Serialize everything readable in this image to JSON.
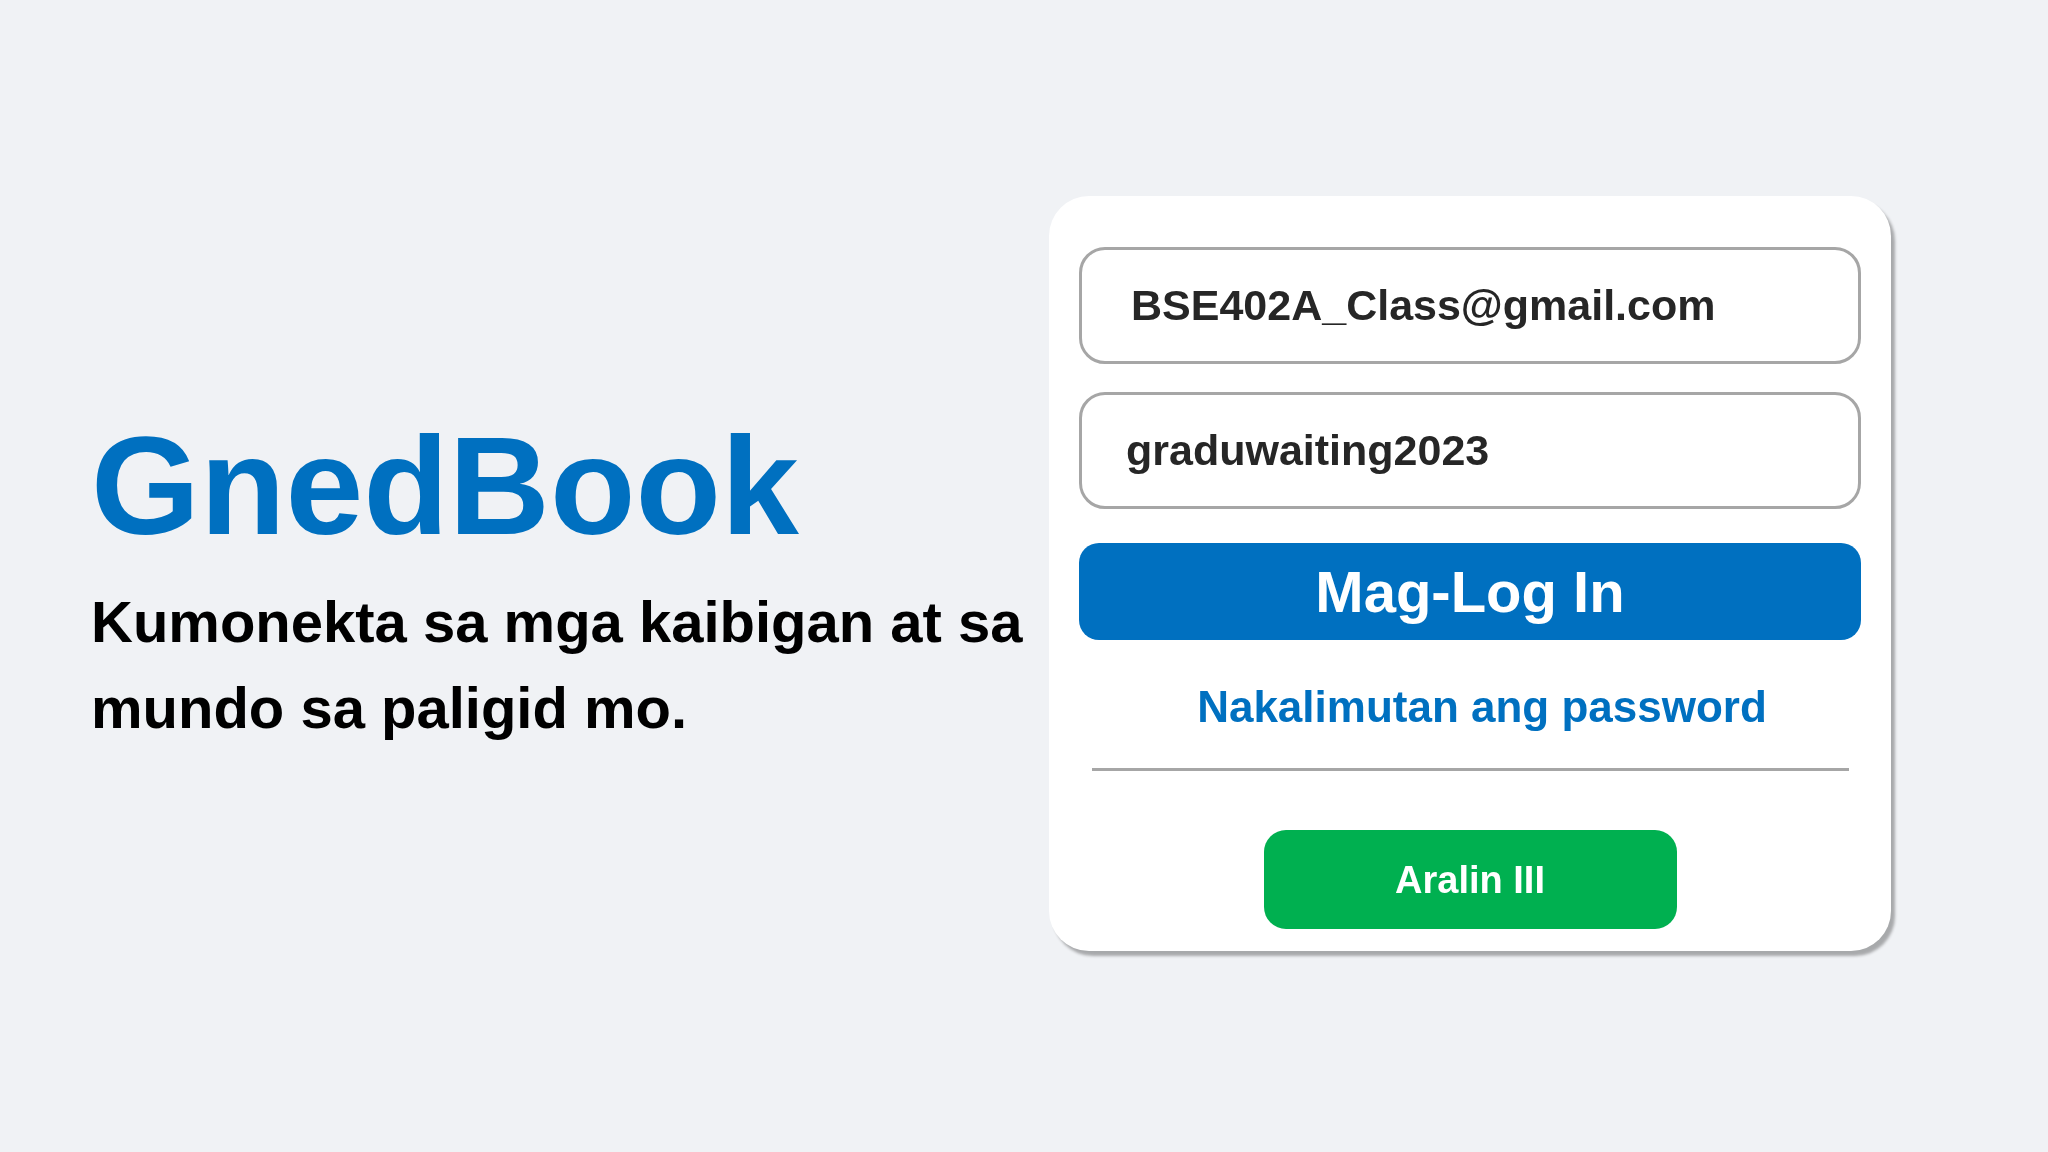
{
  "brand": {
    "logo": "GnedBook",
    "tagline": "Kumonekta sa mga kaibigan at sa mundo sa paligid mo."
  },
  "login_form": {
    "email": {
      "value": "BSE402A_Class@gmail.com"
    },
    "password": {
      "value": "graduwaiting2023"
    },
    "login_button": "Mag-Log In",
    "forgot_password_link": "Nakalimutan ang password",
    "secondary_button": "Aralin III"
  }
}
